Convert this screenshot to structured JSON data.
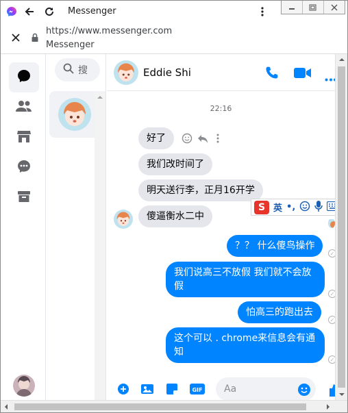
{
  "browser": {
    "tab_title": "Messenger",
    "url": "https://www.messenger.com",
    "page_title": "Messenger",
    "window_buttons": [
      "minimize",
      "restore",
      "close"
    ]
  },
  "sidebar": {
    "items": [
      {
        "icon": "chat-bubble-icon",
        "active": true
      },
      {
        "icon": "people-icon",
        "active": false
      },
      {
        "icon": "marketplace-icon",
        "active": false
      },
      {
        "icon": "message-requests-icon",
        "active": false
      },
      {
        "icon": "archive-icon",
        "active": false
      }
    ]
  },
  "conversations": {
    "search_label": "搜"
  },
  "chat": {
    "contact_name": "Eddie Shi",
    "timestamp": "22:16",
    "incoming": [
      "好了",
      "我们改时间了",
      "明天送行李，正月16开学",
      "傻逼衡水二中"
    ],
    "outgoing": [
      "？？ 什么傻鸟操作",
      "我们说高三不放假 我们就不会放假",
      "怕高三的跑出去",
      "这个可以 . chrome来信息会有通知"
    ],
    "composer_placeholder": "Aa",
    "composer_tools": [
      "plus-icon",
      "photo-icon",
      "sticker-icon",
      "gif-icon"
    ]
  },
  "ime": {
    "logo": "S",
    "mode": "英",
    "punct": "•,"
  },
  "colors": {
    "accent": "#0084ff",
    "incoming_bubble": "#e4e6eb"
  }
}
